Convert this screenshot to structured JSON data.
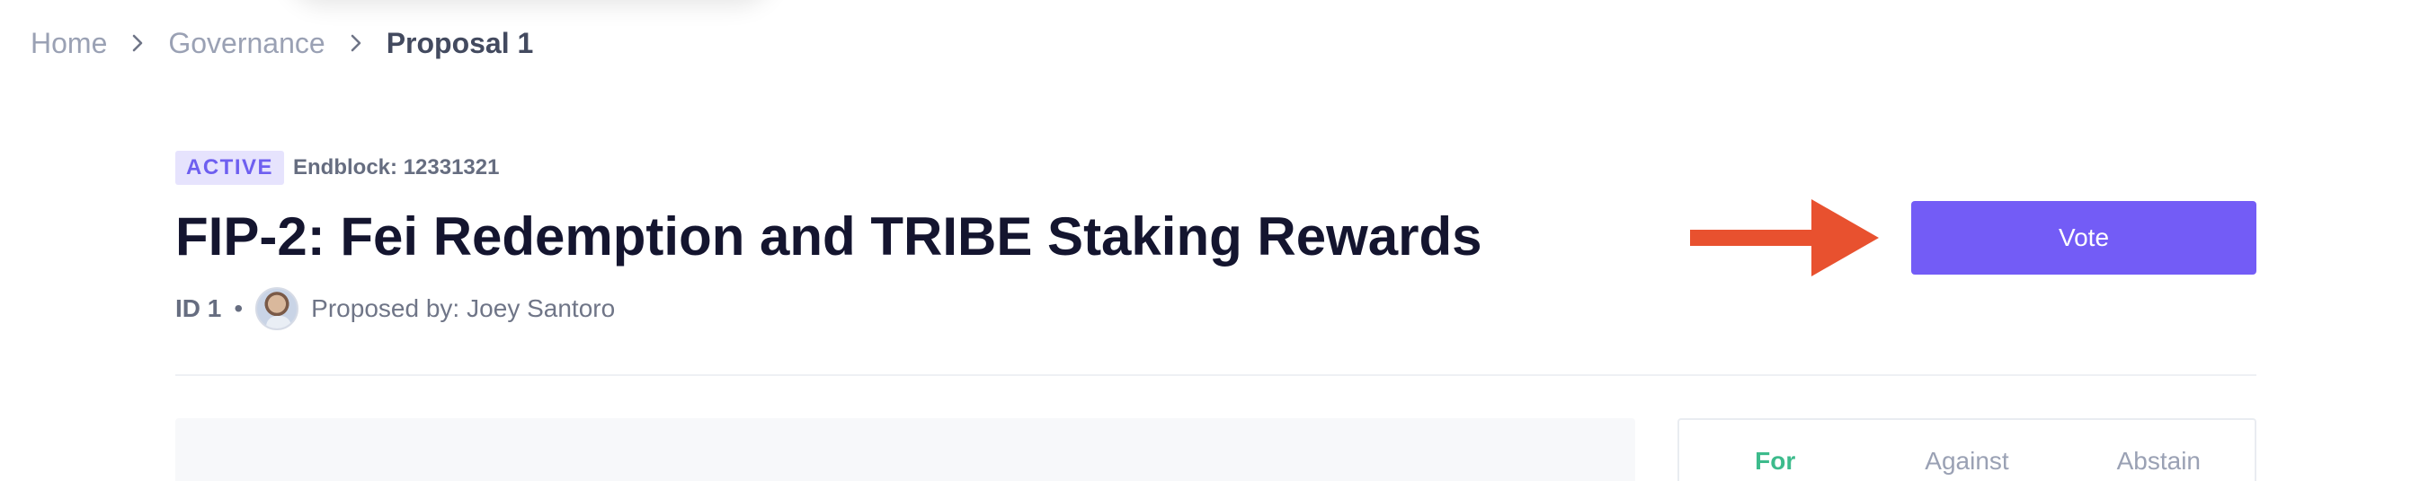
{
  "breadcrumb": {
    "items": [
      {
        "label": "Home"
      },
      {
        "label": "Governance"
      }
    ],
    "current": "Proposal 1"
  },
  "proposal": {
    "status": "ACTIVE",
    "endblock": "Endblock: 12331321",
    "title": "FIP-2: Fei Redemption and TRIBE Staking Rewards",
    "id_label": "ID 1",
    "separator": "•",
    "proposed_by_label": "Proposed by:",
    "proposer": "Joey Santoro"
  },
  "actions": {
    "vote_label": "Vote"
  },
  "votes": {
    "tabs": [
      {
        "label": "For"
      },
      {
        "label": "Against"
      },
      {
        "label": "Abstain"
      }
    ],
    "active_tab": "For"
  },
  "colors": {
    "accent": "#735cf6",
    "arrow": "#e8512f",
    "for_green": "#3dbb8c",
    "title": "#14152f"
  },
  "icons": {
    "breadcrumb_separator": "chevron-right-icon",
    "annotation": "arrow-right-icon"
  }
}
